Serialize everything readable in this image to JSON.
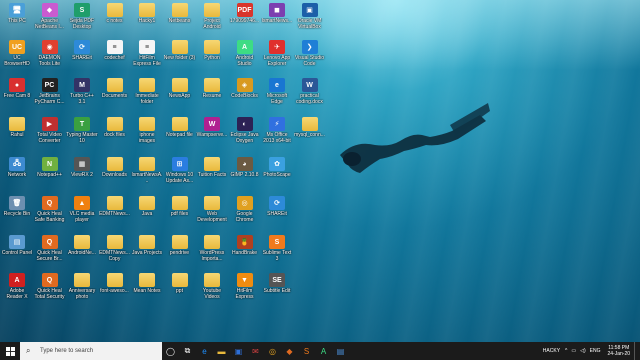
{
  "desktop": {
    "icons": [
      {
        "label": "This PC",
        "type": "app",
        "color": "#4a9fd8",
        "glyph": "🖥"
      },
      {
        "label": "Apache NetBeans I...",
        "type": "app",
        "color": "#c95bd0",
        "glyph": "◆"
      },
      {
        "label": "Sejda PDF Desktop",
        "type": "app",
        "color": "#1f9e6b",
        "glyph": "S"
      },
      {
        "label": "c notes",
        "type": "folder"
      },
      {
        "label": "Hacky1",
        "type": "folder"
      },
      {
        "label": "Netbeans",
        "type": "folder"
      },
      {
        "label": "Project Android",
        "type": "folder"
      },
      {
        "label": "179099746...",
        "type": "app",
        "color": "#d9352b",
        "glyph": "PDF"
      },
      {
        "label": "lsmartNews...",
        "type": "app",
        "color": "#7c3fb0",
        "glyph": "◼"
      },
      {
        "label": "Oracle VM VirtualBox",
        "type": "app",
        "color": "#1c5fa8",
        "glyph": "▣"
      },
      {
        "label": "UC BrowserHD",
        "type": "app",
        "color": "#f0a020",
        "glyph": "UC"
      },
      {
        "label": "DAEMON Tools Lite",
        "type": "app",
        "color": "#e04030",
        "glyph": "◉"
      },
      {
        "label": "SHAREit",
        "type": "app",
        "color": "#2d8ad8",
        "glyph": "⟳"
      },
      {
        "label": "codechef",
        "type": "doc",
        "glyph": "≡"
      },
      {
        "label": "HitFilm Express File",
        "type": "doc",
        "glyph": "≡"
      },
      {
        "label": "New folder (3)",
        "type": "folder"
      },
      {
        "label": "Python",
        "type": "folder"
      },
      {
        "label": "Android Studio",
        "type": "app",
        "color": "#3ddc84",
        "glyph": "A"
      },
      {
        "label": "Lenovo App Explorer",
        "type": "app",
        "color": "#e0302c",
        "glyph": "✈"
      },
      {
        "label": "Visual Studio Code",
        "type": "app",
        "color": "#1f7fd6",
        "glyph": "❯"
      },
      {
        "label": "Free Cam 8",
        "type": "app",
        "color": "#d93030",
        "glyph": "●"
      },
      {
        "label": "JetBrains PyCharm C...",
        "type": "app",
        "color": "#222222",
        "glyph": "PC"
      },
      {
        "label": "Turbo C++ 3.1",
        "type": "app",
        "color": "#333366",
        "glyph": "M"
      },
      {
        "label": "Documents",
        "type": "folder"
      },
      {
        "label": "Immediate folder",
        "type": "folder"
      },
      {
        "label": "NewsApp",
        "type": "folder"
      },
      {
        "label": "Resume",
        "type": "folder"
      },
      {
        "label": "CodeBlocks",
        "type": "app",
        "color": "#d89a20",
        "glyph": "◈"
      },
      {
        "label": "Microsoft Edge",
        "type": "app",
        "color": "#1976d2",
        "glyph": "e"
      },
      {
        "label": "practical coding.docx",
        "type": "app",
        "color": "#2b5797",
        "glyph": "W"
      },
      {
        "label": "Rahul",
        "type": "folder"
      },
      {
        "label": "Total Video Converter",
        "type": "app",
        "color": "#c03030",
        "glyph": "▶"
      },
      {
        "label": "Typing Master 10",
        "type": "app",
        "color": "#3aa040",
        "glyph": "T"
      },
      {
        "label": "dock files",
        "type": "folder"
      },
      {
        "label": "iphone images",
        "type": "folder"
      },
      {
        "label": "Notepad file",
        "type": "folder"
      },
      {
        "label": "Wampserve...",
        "type": "app",
        "color": "#b02090",
        "glyph": "W"
      },
      {
        "label": "Eclipse Java Oxygen",
        "type": "app",
        "color": "#2c2255",
        "glyph": "◐"
      },
      {
        "label": "Ms Office 2013 x64-bit",
        "type": "app",
        "color": "#3070e0",
        "glyph": "⚡"
      },
      {
        "label": "mysql_conn...",
        "type": "folder"
      },
      {
        "label": "Network",
        "type": "app",
        "color": "#3d8ad0",
        "glyph": "🖧"
      },
      {
        "label": "Notepad++",
        "type": "app",
        "color": "#70b040",
        "glyph": "N"
      },
      {
        "label": "ViewRX 2",
        "type": "app",
        "color": "#555555",
        "glyph": "▦"
      },
      {
        "label": "Downloads",
        "type": "folder"
      },
      {
        "label": "lsmartNewsA...",
        "type": "folder"
      },
      {
        "label": "Windows 10 Update As...",
        "type": "app",
        "color": "#2a7de0",
        "glyph": "⊞"
      },
      {
        "label": "Tuition Facts",
        "type": "folder"
      },
      {
        "label": "GIMP 2.10.8",
        "type": "app",
        "color": "#6b5a42",
        "glyph": "◕"
      },
      {
        "label": "PhotoScape",
        "type": "app",
        "color": "#3aa0e0",
        "glyph": "✿"
      },
      {
        "label": "Recycle Bin",
        "type": "app",
        "color": "#6d8fb0",
        "glyph": "🗑"
      },
      {
        "label": "Quick Heal Safe Banking",
        "type": "app",
        "color": "#e06a20",
        "glyph": "Q"
      },
      {
        "label": "VLC media player",
        "type": "app",
        "color": "#f08010",
        "glyph": "▲"
      },
      {
        "label": "EDMTNews...",
        "type": "folder"
      },
      {
        "label": "Java",
        "type": "folder"
      },
      {
        "label": "pdf files",
        "type": "folder"
      },
      {
        "label": "Web Development",
        "type": "folder"
      },
      {
        "label": "Google Chrome",
        "type": "app",
        "color": "#e0a020",
        "glyph": "◎"
      },
      {
        "label": "SHAREit",
        "type": "app",
        "color": "#2d8ad8",
        "glyph": "⟳"
      },
      {
        "label": "Control Panel",
        "type": "app",
        "color": "#5a9ad0",
        "glyph": "▤"
      },
      {
        "label": "Quick Heal Secure Br...",
        "type": "app",
        "color": "#e06a20",
        "glyph": "Q"
      },
      {
        "label": "AndroidNe...",
        "type": "folder"
      },
      {
        "label": "EDMTNews... Copy",
        "type": "folder"
      },
      {
        "label": "Java Projects",
        "type": "folder"
      },
      {
        "label": "pendrive",
        "type": "folder"
      },
      {
        "label": "WordPress Importa...",
        "type": "folder"
      },
      {
        "label": "HandBrake",
        "type": "app",
        "color": "#b04020",
        "glyph": "🍍"
      },
      {
        "label": "Sublime Text 3",
        "type": "app",
        "color": "#f07a1c",
        "glyph": "S"
      },
      {
        "label": "Adobe Reader X",
        "type": "app",
        "color": "#d02020",
        "glyph": "A"
      },
      {
        "label": "Quick Heal Total Security",
        "type": "app",
        "color": "#e06a20",
        "glyph": "Q"
      },
      {
        "label": "Anniversary photo",
        "type": "folder"
      },
      {
        "label": "font-aweso...",
        "type": "folder"
      },
      {
        "label": "Mean Notes",
        "type": "folder"
      },
      {
        "label": "ppt",
        "type": "folder"
      },
      {
        "label": "Youtube Videos",
        "type": "folder"
      },
      {
        "label": "HitFilm Express",
        "type": "app",
        "color": "#f08c10",
        "glyph": "▼"
      },
      {
        "label": "Subtitle Edit",
        "type": "app",
        "color": "#555555",
        "glyph": "SE"
      }
    ]
  },
  "taskbar": {
    "search_placeholder": "Type here to search",
    "pinned": [
      {
        "name": "task-view",
        "glyph": "◯",
        "color": "#ffffff"
      },
      {
        "name": "task-switch",
        "glyph": "⧉",
        "color": "#ffffff"
      },
      {
        "name": "edge",
        "glyph": "e",
        "color": "#1e90ff"
      },
      {
        "name": "file-explorer",
        "glyph": "▬",
        "color": "#e9b93c"
      },
      {
        "name": "store",
        "glyph": "▣",
        "color": "#2d6fd8"
      },
      {
        "name": "mail",
        "glyph": "✉",
        "color": "#d04040"
      },
      {
        "name": "chrome",
        "glyph": "◎",
        "color": "#e0a020"
      },
      {
        "name": "app-orange",
        "glyph": "◆",
        "color": "#e06a20"
      },
      {
        "name": "app-sublime",
        "glyph": "S",
        "color": "#f07a1c"
      },
      {
        "name": "android-studio",
        "glyph": "A",
        "color": "#3ddc84"
      },
      {
        "name": "app-blue",
        "glyph": "▤",
        "color": "#4a8fd8"
      }
    ],
    "tray_user": "HACKY",
    "tray_icons": [
      "^",
      "▭",
      "◁)",
      "ENG"
    ],
    "time": "11:58 PM",
    "date": "24-Jan-20"
  }
}
